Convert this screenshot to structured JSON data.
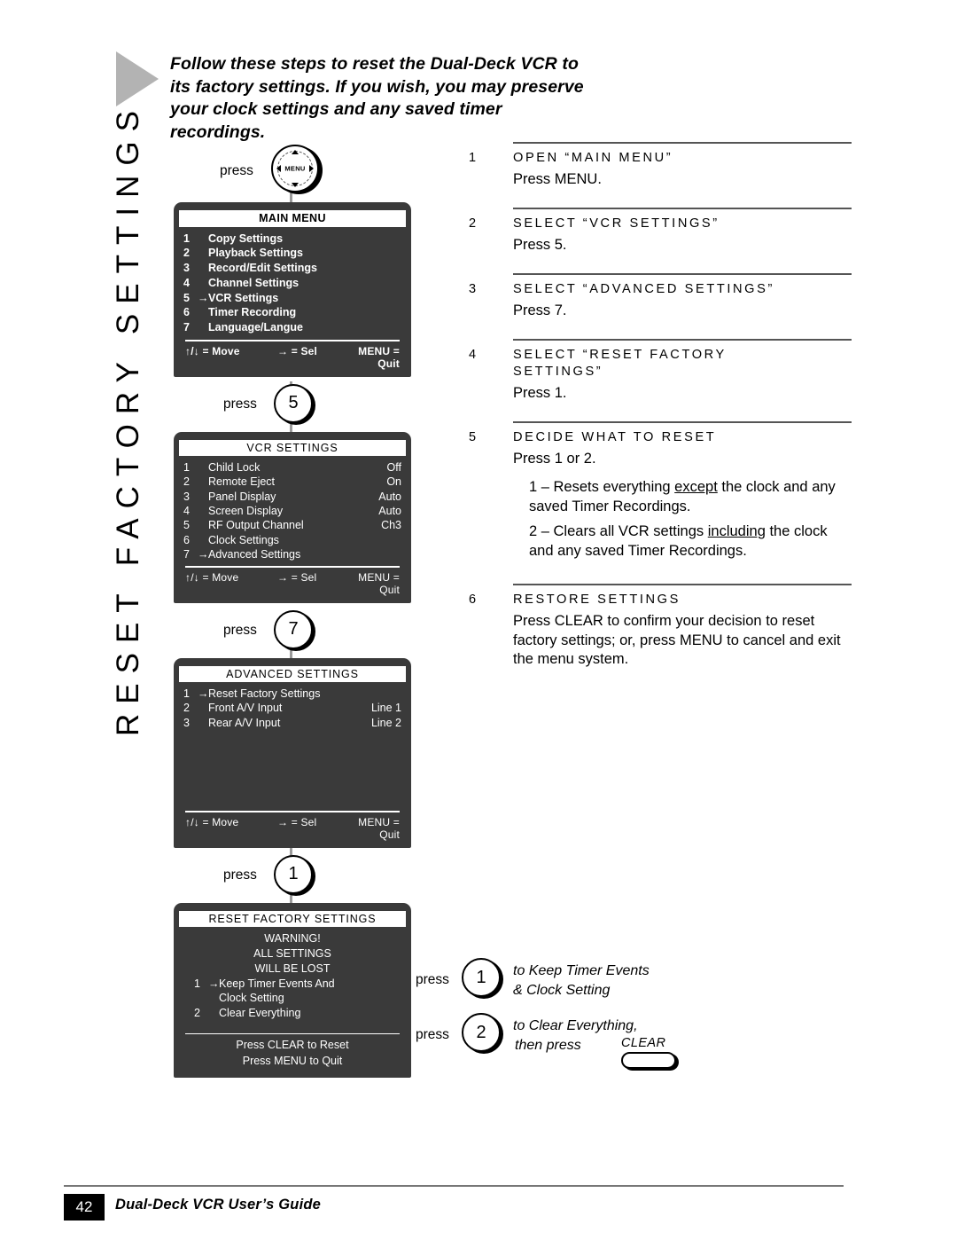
{
  "sidebar": {
    "title": "RESET FACTORY SETTINGS"
  },
  "intro": {
    "text": "Follow these steps to reset the Dual-Deck VCR to its factory settings. If you wish, you may preserve your clock settings and any saved timer recordings."
  },
  "flow": {
    "press_label": "press",
    "menu_button": {
      "label": "MENU",
      "icon": "dpad-menu-icon"
    },
    "step_buttons": {
      "five": "5",
      "seven": "7",
      "one": "1"
    },
    "screens": [
      {
        "title": "MAIN MENU",
        "rows": [
          {
            "num": "1",
            "arrow": "",
            "label": "Copy Settings",
            "value": ""
          },
          {
            "num": "2",
            "arrow": "",
            "label": "Playback Settings",
            "value": ""
          },
          {
            "num": "3",
            "arrow": "",
            "label": "Record/Edit Settings",
            "value": ""
          },
          {
            "num": "4",
            "arrow": "",
            "label": "Channel Settings",
            "value": ""
          },
          {
            "num": "5",
            "arrow": "→",
            "label": "VCR Settings",
            "value": ""
          },
          {
            "num": "6",
            "arrow": "",
            "label": "Timer Recording",
            "value": ""
          },
          {
            "num": "7",
            "arrow": "",
            "label": "Language/Langue",
            "value": ""
          }
        ],
        "footer": {
          "move": "↑/↓ = Move",
          "sel": "→ = Sel",
          "quit": "MENU = Quit"
        }
      },
      {
        "title": "VCR SETTINGS",
        "rows": [
          {
            "num": "1",
            "arrow": "",
            "label": "Child Lock",
            "value": "Off"
          },
          {
            "num": "2",
            "arrow": "",
            "label": "Remote Eject",
            "value": "On"
          },
          {
            "num": "3",
            "arrow": "",
            "label": "Panel Display",
            "value": "Auto"
          },
          {
            "num": "4",
            "arrow": "",
            "label": "Screen Display",
            "value": "Auto"
          },
          {
            "num": "5",
            "arrow": "",
            "label": "RF Output Channel",
            "value": "Ch3"
          },
          {
            "num": "6",
            "arrow": "",
            "label": "Clock Settings",
            "value": ""
          },
          {
            "num": "7",
            "arrow": "→",
            "label": "Advanced Settings",
            "value": ""
          }
        ],
        "footer": {
          "move": "↑/↓ = Move",
          "sel": "→ = Sel",
          "quit": "MENU = Quit"
        }
      },
      {
        "title": "ADVANCED SETTINGS",
        "rows": [
          {
            "num": "1",
            "arrow": "→",
            "label": "Reset Factory Settings",
            "value": ""
          },
          {
            "num": "2",
            "arrow": "",
            "label": "Front A/V Input",
            "value": "Line 1"
          },
          {
            "num": "3",
            "arrow": "",
            "label": "Rear A/V Input",
            "value": "Line 2"
          }
        ],
        "footer": {
          "move": "↑/↓ = Move",
          "sel": "→ = Sel",
          "quit": "MENU = Quit"
        }
      },
      {
        "title": "RESET FACTORY SETTINGS",
        "warning": [
          "WARNING!",
          "ALL SETTINGS",
          "WILL BE LOST"
        ],
        "rows": [
          {
            "num": "1",
            "arrow": "→",
            "label": "Keep Timer Events And",
            "value": ""
          },
          {
            "num": "",
            "arrow": "",
            "label": "Clock Setting",
            "value": ""
          },
          {
            "num": "2",
            "arrow": "",
            "label": "Clear Everything",
            "value": ""
          }
        ],
        "footer_lines": [
          "Press CLEAR to Reset",
          "Press MENU to Quit"
        ]
      }
    ]
  },
  "steps": [
    {
      "num": "1",
      "title": "OPEN “MAIN MENU”",
      "body": "Press MENU."
    },
    {
      "num": "2",
      "title": "SELECT “VCR SETTINGS”",
      "body": "Press 5."
    },
    {
      "num": "3",
      "title": "SELECT “ADVANCED SETTINGS”",
      "body": "Press 7."
    },
    {
      "num": "4",
      "title": "SELECT “RESET FACTORY SETTINGS”",
      "body": "Press 1."
    },
    {
      "num": "5",
      "title": "DECIDE WHAT TO RESET",
      "body": "Press 1 or 2.",
      "sub1_pre": "1 – Resets everything ",
      "sub1_u": "except",
      "sub1_post": " the clock and any saved Timer Recordings.",
      "sub2_pre": "2 – Clears all VCR settings ",
      "sub2_u": "including",
      "sub2_post": " the clock and any saved Timer Recordings."
    },
    {
      "num": "6",
      "title": "RESTORE SETTINGS",
      "body": "Press CLEAR to confirm your decision to reset factory settings; or, press MENU to cancel and exit the menu system."
    }
  ],
  "notes": {
    "press_label": "press",
    "note1_button": "1",
    "note1_text_line1": "to Keep Timer Events",
    "note1_text_line2": "& Clock Setting",
    "note2_button": "2",
    "note2_text": "to Clear Everything,",
    "then_press": "then press",
    "clear_label": "CLEAR"
  },
  "footer": {
    "page_number": "42",
    "title": "Dual-Deck VCR User’s Guide"
  }
}
